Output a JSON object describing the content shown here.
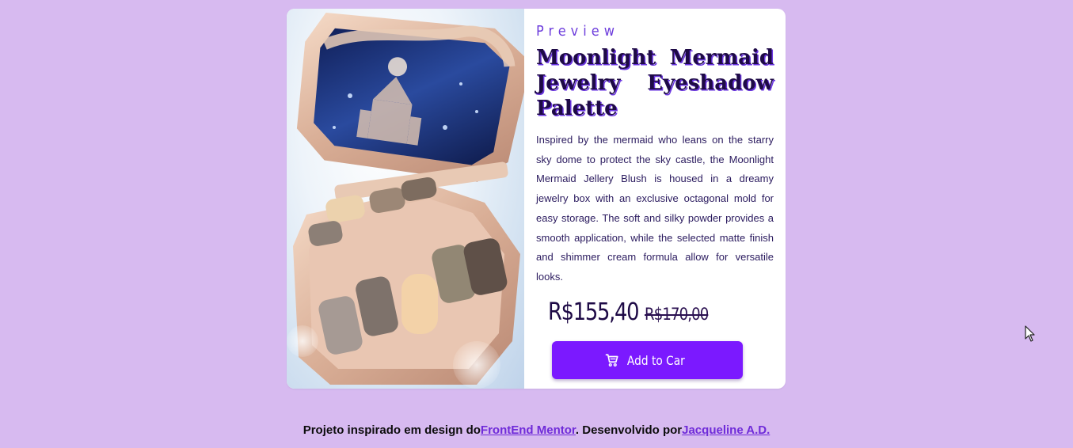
{
  "card": {
    "eyebrow": "Preview",
    "title": "Moonlight Mermaid Jewelry Eyeshadow Palette",
    "description": " Inspired by the mermaid who leans on the starry sky dome to protect the sky castle, the Moonlight Mermaid Jellery Blush is housed in a dreamy jewelry box with an exclusive octagonal mold for easy storage. The soft and silky powder provides a smooth application, while the selected matte finish and shimmer cream formula allow for versatile looks.",
    "price_current": "R$155,40",
    "price_original": "R$170,00",
    "cart_button_label": "Add to Car",
    "cart_icon": "shopping-cart-icon",
    "image_alt": "product-image"
  },
  "footer": {
    "prefix": "Projeto inspirado em design do",
    "link1": "FrontEnd Mentor",
    "middle": ". Desenvolvido por",
    "link2": "Jacqueline A.D."
  },
  "colors": {
    "background": "#d7baf0",
    "accent": "#7b19ff",
    "title": "#1e0a46",
    "eyebrow": "#6d3ddc",
    "link": "#6f2bd9"
  }
}
